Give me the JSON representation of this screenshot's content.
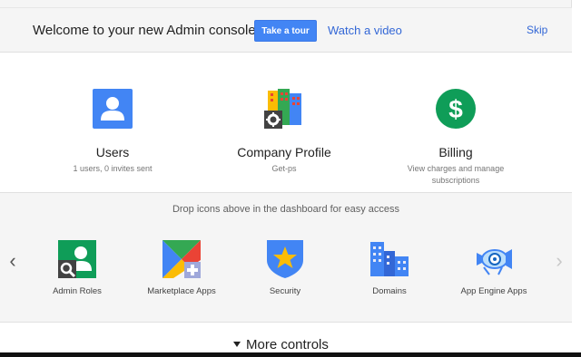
{
  "banner": {
    "title": "Welcome to your new Admin console",
    "tour_label": "Take a tour",
    "video_label": "Watch a video",
    "skip_label": "Skip"
  },
  "cards": [
    {
      "title": "Users",
      "subtitle": "1 users, 0 invites sent",
      "icon": "user-icon"
    },
    {
      "title": "Company Profile",
      "subtitle": "Get-ps",
      "icon": "company-building-icon"
    },
    {
      "title": "Billing",
      "subtitle": "View charges and manage subscriptions",
      "icon": "dollar-icon"
    }
  ],
  "tray": {
    "hint": "Drop icons above in the dashboard for easy access",
    "apps": [
      {
        "label": "Admin Roles",
        "icon": "admin-roles-icon"
      },
      {
        "label": "Marketplace Apps",
        "icon": "marketplace-icon"
      },
      {
        "label": "Security",
        "icon": "security-shield-icon"
      },
      {
        "label": "Domains",
        "icon": "domains-building-icon"
      },
      {
        "label": "App Engine Apps",
        "icon": "app-engine-icon"
      }
    ],
    "prev_arrow": "‹",
    "next_arrow": "›"
  },
  "more_controls": {
    "label": "More controls"
  },
  "colors": {
    "accent_blue": "#4285f4",
    "link_blue": "#3367d6",
    "billing_green": "#0f9d58"
  }
}
